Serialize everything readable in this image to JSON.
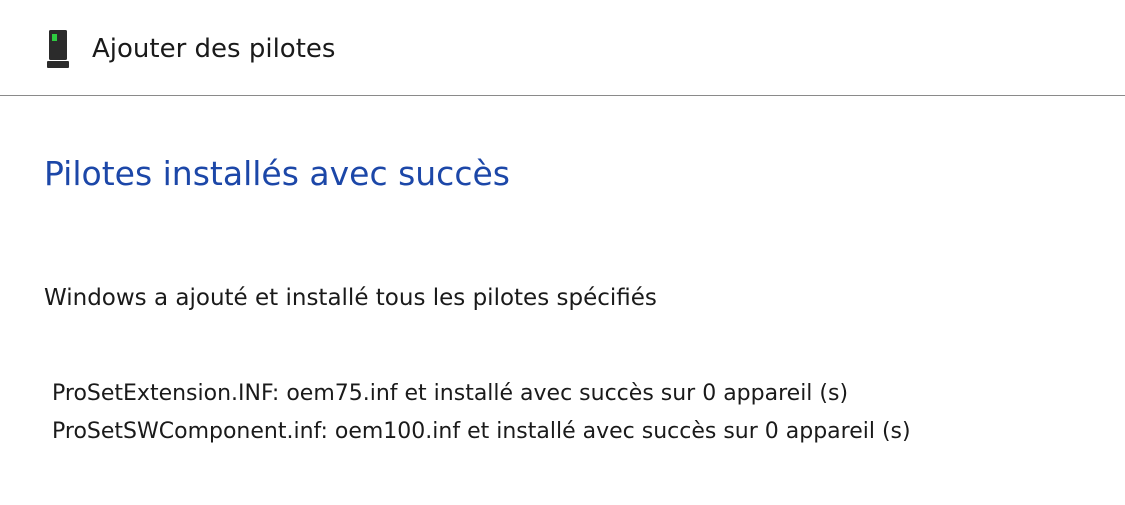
{
  "window": {
    "title": "Ajouter des pilotes",
    "icon": "device-icon"
  },
  "main": {
    "heading": "Pilotes installés avec succès",
    "message": "Windows a ajouté et installé tous les pilotes spécifiés",
    "details": [
      "ProSetExtension.INF: oem75.inf et installé avec succès sur 0 appareil (s)",
      "ProSetSWComponent.inf: oem100.inf et installé avec succès sur 0 appareil (s)"
    ]
  },
  "colors": {
    "heading": "#1c47a8",
    "icon_body": "#2b2b2b",
    "icon_light": "#2ecc40"
  }
}
